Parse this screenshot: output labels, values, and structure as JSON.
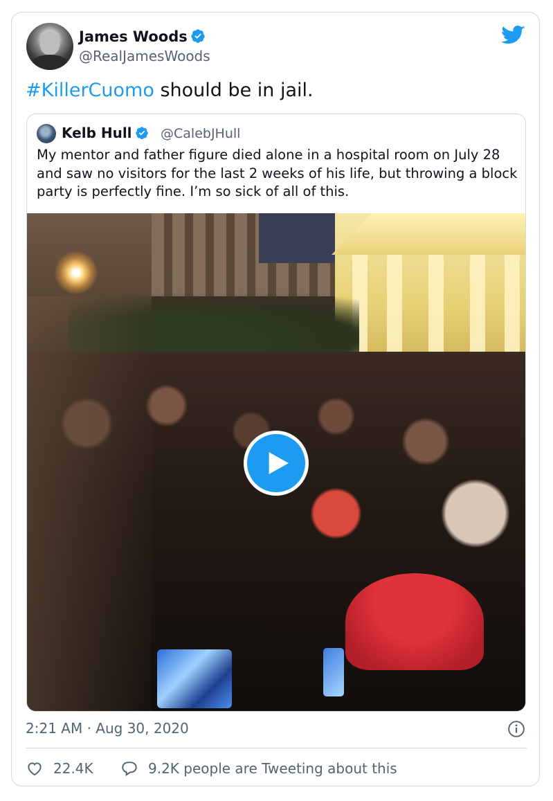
{
  "tweet": {
    "author_name": "James Woods",
    "author_handle": "@RealJamesWoods",
    "text_hashtag": "#KillerCuomo",
    "text_rest": " should be in jail.",
    "timestamp": "2:21 AM · Aug 30, 2020",
    "likes": "22.4K",
    "reply_text": "9.2K people are Tweeting about this"
  },
  "quoted": {
    "author_name": "Kelb Hull",
    "author_handle": "@CalebJHull",
    "text": "My mentor and father figure died alone in a hospital room on July 28 and saw no visitors for the last 2 weeks of his life, but throwing a block party is perfectly fine. I’m so sick of all of this."
  },
  "colors": {
    "brand": "#1d9bf0",
    "text": "#0f1419",
    "secondary": "#536471",
    "border": "#cfd9de"
  },
  "icons": [
    "twitter-bird-icon",
    "verified-badge-icon",
    "play-icon",
    "info-icon",
    "heart-icon",
    "reply-bubble-icon"
  ]
}
